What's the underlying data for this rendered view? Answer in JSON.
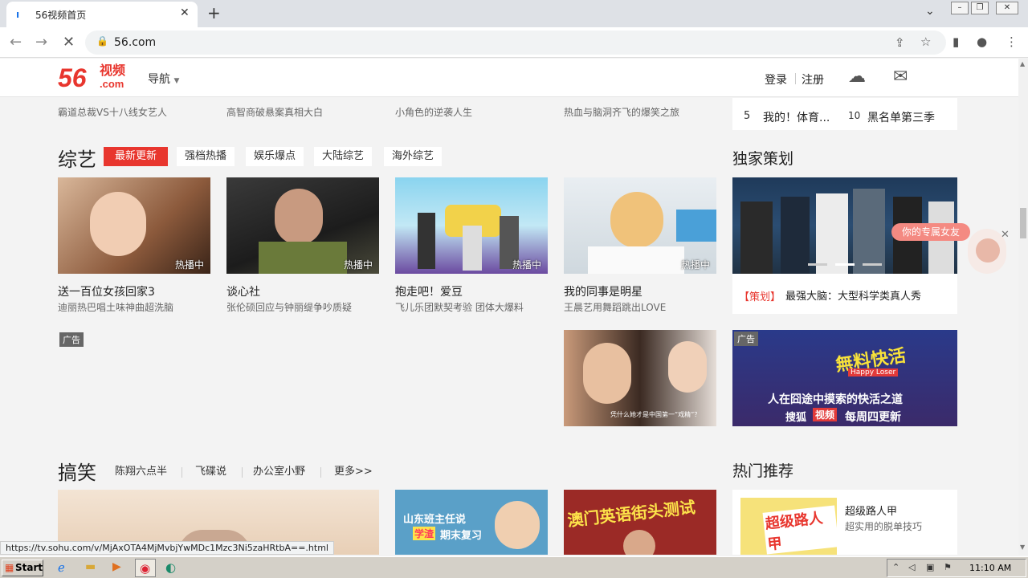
{
  "browser": {
    "tab_title": "56视频首页",
    "url": "56.com",
    "status_url": "https://tv.sohu.com/v/MjAxOTA4MjMvbjYwMDc1Mzc3Ni5zaHRtbA==.html"
  },
  "header": {
    "logo_num": "56",
    "logo_cn": "视频",
    "logo_com": ".com",
    "nav_label": "导航",
    "login": "登录",
    "register": "注册"
  },
  "top_row": {
    "items": [
      {
        "title": "霸道总裁VS十八线女艺人"
      },
      {
        "title": "高智商破悬案真相大白"
      },
      {
        "title": "小角色的逆袭人生"
      },
      {
        "title": "热血与脑洞齐飞的爆笑之旅"
      }
    ],
    "rank": [
      {
        "num": "5",
        "text": "我的！体育..."
      },
      {
        "num": "10",
        "text": "黑名单第三季"
      }
    ]
  },
  "variety": {
    "title": "综艺",
    "tabs": [
      "最新更新",
      "强档热播",
      "娱乐爆点",
      "大陆综艺",
      "海外综艺"
    ],
    "cards": [
      {
        "title": "送一百位女孩回家3",
        "desc": "迪丽热巴唱土味神曲超洗脑",
        "badge": "热播中"
      },
      {
        "title": "谈心社",
        "desc": "张伦硕回应与钟丽缇争吵质疑",
        "badge": "热播中"
      },
      {
        "title": "抱走吧！爱豆",
        "desc": "飞儿乐团默契考验 团体大爆料",
        "badge": "热播中"
      },
      {
        "title": "我的同事是明星",
        "desc": "王晨艺用舞蹈跳出LOVE",
        "badge": "热播中"
      }
    ],
    "ad_label": "广告",
    "clip_caption": "凭什么她才是中国第一“戏精”？"
  },
  "exclusive": {
    "title": "独家策划",
    "tag": "【策划】",
    "text": "最强大脑：大型科学类真人秀",
    "ad_label": "广告",
    "ad_line1": "無料快活",
    "ad_line2": "Happy Loser",
    "ad_line3": "人在囧途中摸索的快活之道",
    "ad_line4": "搜狐",
    "ad_line5": "视频",
    "ad_line6": "每周四更新"
  },
  "float": {
    "label": "你的专属女友"
  },
  "funny": {
    "title": "搞笑",
    "tabs": [
      "陈翔六点半",
      "飞碟说",
      "办公室小野",
      "更多>>"
    ],
    "card2_text1": "山东班主任说",
    "card2_text2": "学渣",
    "card2_text3": "期末复习",
    "card3_text": "澳门英语街头测试"
  },
  "hot": {
    "title": "热门推荐",
    "item_title": "超级路人甲",
    "item_desc": "超实用的脱单技巧",
    "thumb_text": "超级路人甲"
  },
  "taskbar": {
    "start": "Start",
    "time": "11:10 AM"
  },
  "colors": {
    "brand_red": "#e8362e",
    "accent": "#1a73e8"
  }
}
